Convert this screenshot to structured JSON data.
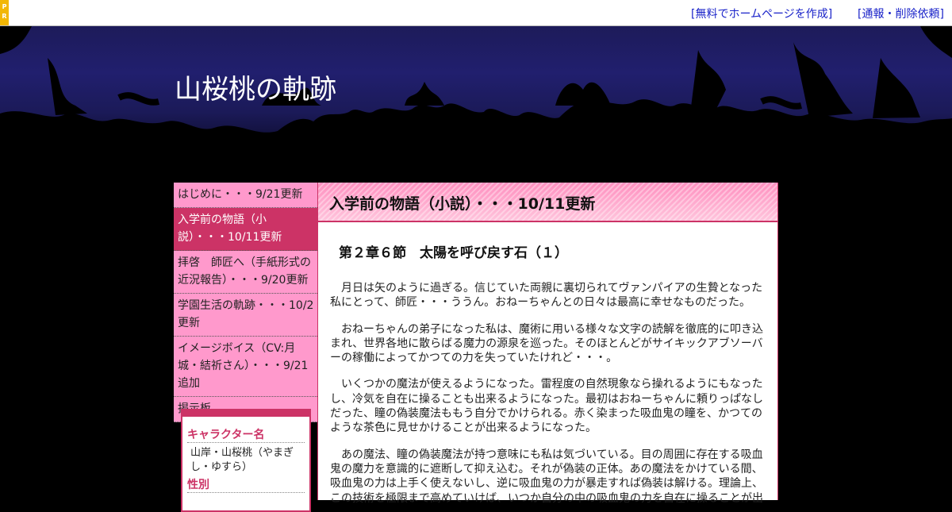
{
  "topbar": {
    "pr_label": [
      "P",
      "R"
    ],
    "link_create": "[無料でホームページを作成]",
    "link_report": "[通報・削除依頼]"
  },
  "header": {
    "site_title": "山桜桃の軌跡"
  },
  "sidebar": {
    "items": [
      {
        "label": "はじめに・・・9/21更新",
        "active": false
      },
      {
        "label": "入学前の物語（小説）・・・10/11更新",
        "active": true
      },
      {
        "label": "拝啓　師匠へ（手紙形式の近況報告）・・・9/20更新",
        "active": false
      },
      {
        "label": "学園生活の軌跡・・・10/2更新",
        "active": false
      },
      {
        "label": "イメージボイス（CV:月城・結祈さん）・・・9/21追加",
        "active": false
      },
      {
        "label": "掲示板",
        "active": false
      }
    ],
    "profile": {
      "name_label": "キャラクター名",
      "name_value": "山岸・山桜桃（やまぎし・ゆすら）",
      "gender_label": "性別"
    }
  },
  "content": {
    "page_heading": "入学前の物語（小説）・・・10/11更新",
    "section_title": "第２章６節　太陽を呼び戻す石（１）",
    "paragraphs": [
      "月日は矢のように過ぎる。信じていた両親に裏切られてヴァンパイアの生贄となった私にとって、師匠・・・ううん。おねーちゃんとの日々は最高に幸せなものだった。",
      "おねーちゃんの弟子になった私は、魔術に用いる様々な文字の読解を徹底的に叩き込まれ、世界各地に散らばる魔力の源泉を巡った。そのほとんどがサイキックアブソーバーの稼働によってかつての力を失っていたけれど・・・。",
      "いくつかの魔法が使えるようになった。雷程度の自然現象なら操れるようにもなったし、冷気を自在に操ることも出来るようになった。最初はおねーちゃんに頼りっぱなしだった、瞳の偽装魔法ももう自分でかけられる。赤く染まった吸血鬼の瞳を、かつてのような茶色に見せかけることが出来るようになった。",
      "あの魔法、瞳の偽装魔法が持つ意味にも私は気づいている。目の周囲に存在する吸血鬼の魔力を意識的に遮断して抑え込む。それが偽装の正体。あの魔法をかけている間、吸血鬼の力は上手く使えないし、逆に吸血鬼の力が暴走すれば偽装は解ける。理論上、この技術を極限まで高めていけば、いつか自分の中の吸血鬼の力を自在に操ることが出"
    ]
  },
  "colors": {
    "nav_bg": "#ff99cc",
    "nav_active": "#cc3366",
    "accent": "#cc3366",
    "link": "#1a23c9"
  }
}
